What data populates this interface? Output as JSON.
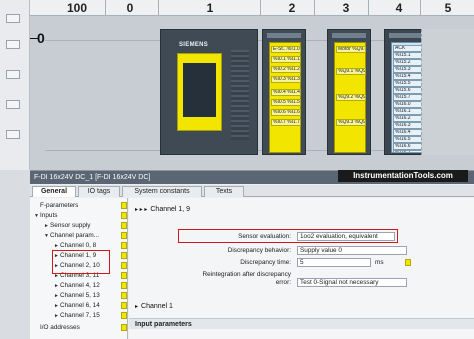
{
  "device_view": {
    "slot_numbers": [
      "100",
      "0",
      "1",
      "2",
      "3",
      "4",
      "5"
    ],
    "rail_label": "0",
    "cpu_logo": "SIEMENS",
    "module2": {
      "tags": [
        "E-St...%I1.0",
        "%I0.1 %I1.1",
        "%I0.2 %I1.2",
        "%I0.3 %I1.3",
        "%I0.4 %I1.4",
        "%I0.5 %I1.5",
        "%I0.6 %I1.6",
        "%I0.7 %I1.7"
      ]
    },
    "module3": {
      "tags": [
        "Motor %Q9.4",
        "%Q9.1 %Q9.5",
        "%Q9.2 %Q9.6",
        "%Q9.3 %Q9.7"
      ]
    },
    "module4": {
      "tags": [
        "ACK",
        "%I15.1",
        "%I15.2",
        "%I15.3",
        "%I15.4",
        "%I15.5",
        "%I15.6",
        "%I15.7",
        "%I16.0",
        "%I16.1",
        "%I16.2",
        "%I16.3",
        "%I16.4",
        "%I16.5",
        "%I16.6",
        "%I16.7"
      ]
    },
    "watermark": "InstrumentationTools.com"
  },
  "properties": {
    "title": "F-DI 16x24V DC_1 [F-DI 16x24V DC]",
    "tabs": [
      "General",
      "IO tags",
      "System constants",
      "Texts"
    ],
    "active_tab": "General",
    "nav": [
      {
        "label": "F-parameters",
        "indent": 0,
        "arrow": ""
      },
      {
        "label": "Inputs",
        "indent": 0,
        "arrow": "▼"
      },
      {
        "label": "Sensor supply",
        "indent": 1,
        "arrow": "►"
      },
      {
        "label": "Channel param...",
        "indent": 1,
        "arrow": "▼"
      },
      {
        "label": "Channel 0, 8",
        "indent": 2,
        "arrow": "►"
      },
      {
        "label": "Channel 1, 9",
        "indent": 2,
        "arrow": "►"
      },
      {
        "label": "Channel 2, 10",
        "indent": 2,
        "arrow": "►"
      },
      {
        "label": "Channel 3, 11",
        "indent": 2,
        "arrow": "►"
      },
      {
        "label": "Channel 4, 12",
        "indent": 2,
        "arrow": "►"
      },
      {
        "label": "Channel 5, 13",
        "indent": 2,
        "arrow": "►"
      },
      {
        "label": "Channel 6, 14",
        "indent": 2,
        "arrow": "►"
      },
      {
        "label": "Channel 7, 15",
        "indent": 2,
        "arrow": "►"
      },
      {
        "label": "I/O addresses",
        "indent": 0,
        "arrow": ""
      }
    ],
    "content": {
      "section1": "Channel 1, 9",
      "sensor_evaluation_label": "Sensor evaluation:",
      "sensor_evaluation_value": "1oo2 evaluation, equivalent",
      "discrepancy_behavior_label": "Discrepancy behavior:",
      "discrepancy_behavior_value": "Supply value 0",
      "discrepancy_time_label": "Discrepancy time:",
      "discrepancy_time_value": "5",
      "discrepancy_time_unit": "ms",
      "reintegration_label_line1": "Reintegration after discrepancy",
      "reintegration_label_line2": "error:",
      "reintegration_value": "Test 0-Signal not necessary",
      "section2": "Channel 1",
      "input_params": "Input parameters"
    }
  }
}
